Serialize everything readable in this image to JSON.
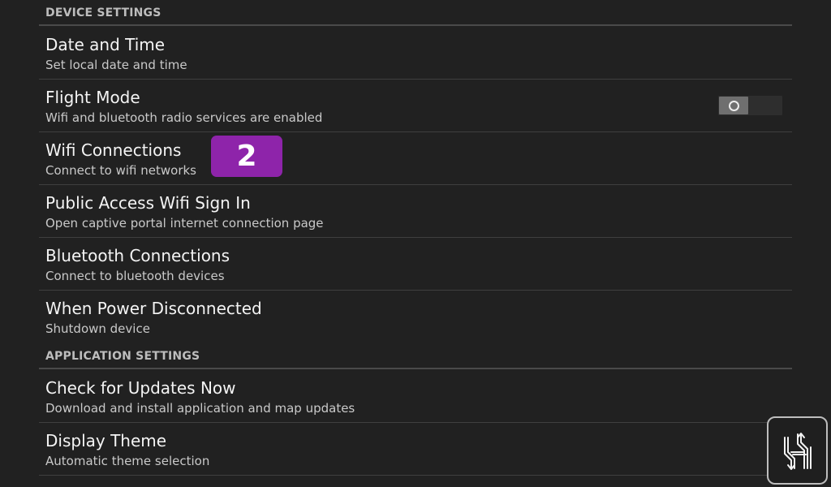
{
  "sections": {
    "device": {
      "header": "DEVICE SETTINGS"
    },
    "application": {
      "header": "APPLICATION SETTINGS"
    }
  },
  "settings": [
    {
      "title": "Date and Time",
      "subtitle": "Set local date and time"
    },
    {
      "title": "Flight Mode",
      "subtitle": "Wifi and bluetooth radio services are enabled",
      "toggle_on": false
    },
    {
      "title": "Wifi Connections",
      "subtitle": "Connect to wifi networks"
    },
    {
      "title": "Public Access Wifi Sign In",
      "subtitle": "Open captive portal internet connection page"
    },
    {
      "title": "Bluetooth Connections",
      "subtitle": "Connect to bluetooth devices"
    },
    {
      "title": "When Power Disconnected",
      "subtitle": "Shutdown device"
    },
    {
      "title": "Check for Updates Now",
      "subtitle": "Download and install application and map updates"
    },
    {
      "title": "Display Theme",
      "subtitle": "Automatic theme selection"
    }
  ],
  "step_badge": {
    "label": "2",
    "color": "#8e24aa"
  },
  "logo": {
    "icon": "h-arrows-logo-icon"
  },
  "colors": {
    "background": "#212121",
    "badge": "#8e24aa"
  }
}
